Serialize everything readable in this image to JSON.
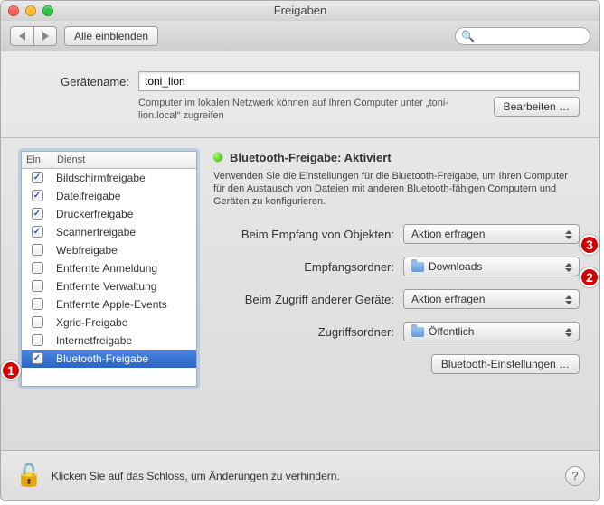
{
  "window": {
    "title": "Freigaben"
  },
  "traffic_colors": {
    "close": "#ff5f57",
    "min": "#ffbd2e",
    "zoom": "#28c940"
  },
  "toolbar": {
    "back_enabled": true,
    "forward_enabled": true,
    "show_all_label": "Alle einblenden",
    "search_placeholder": ""
  },
  "device": {
    "label": "Gerätename:",
    "value": "toni_lion",
    "description": "Computer im lokalen Netzwerk können auf Ihren Computer unter „toni-lion.local“ zugreifen",
    "edit_label": "Bearbeiten …"
  },
  "services": {
    "head_on": "Ein",
    "head_name": "Dienst",
    "items": [
      {
        "label": "Bildschirmfreigabe",
        "checked": true
      },
      {
        "label": "Dateifreigabe",
        "checked": true
      },
      {
        "label": "Druckerfreigabe",
        "checked": true
      },
      {
        "label": "Scannerfreigabe",
        "checked": true
      },
      {
        "label": "Webfreigabe",
        "checked": false
      },
      {
        "label": "Entfernte Anmeldung",
        "checked": false
      },
      {
        "label": "Entfernte Verwaltung",
        "checked": false
      },
      {
        "label": "Entfernte Apple-Events",
        "checked": false
      },
      {
        "label": "Xgrid-Freigabe",
        "checked": false
      },
      {
        "label": "Internetfreigabe",
        "checked": false
      },
      {
        "label": "Bluetooth-Freigabe",
        "checked": true,
        "selected": true
      }
    ]
  },
  "detail": {
    "status_title": "Bluetooth-Freigabe: Aktiviert",
    "status_desc": "Verwenden Sie die Einstellungen für die Bluetooth-Freigabe, um Ihren Computer für den Austausch von Dateien mit anderen Bluetooth-fähigen Computern und Geräten zu konfigurieren.",
    "rows": {
      "receive_label": "Beim Empfang von Objekten:",
      "receive_value": "Aktion erfragen",
      "receive_folder_label": "Empfangsordner:",
      "receive_folder_value": "Downloads",
      "access_label": "Beim Zugriff anderer Geräte:",
      "access_value": "Aktion erfragen",
      "access_folder_label": "Zugriffsordner:",
      "access_folder_value": "Öffentlich"
    },
    "settings_btn": "Bluetooth-Einstellungen …"
  },
  "footer": {
    "lock_text": "Klicken Sie auf das Schloss, um Änderungen zu verhindern."
  },
  "annotations": {
    "a1": "1",
    "a2": "2",
    "a3": "3"
  }
}
